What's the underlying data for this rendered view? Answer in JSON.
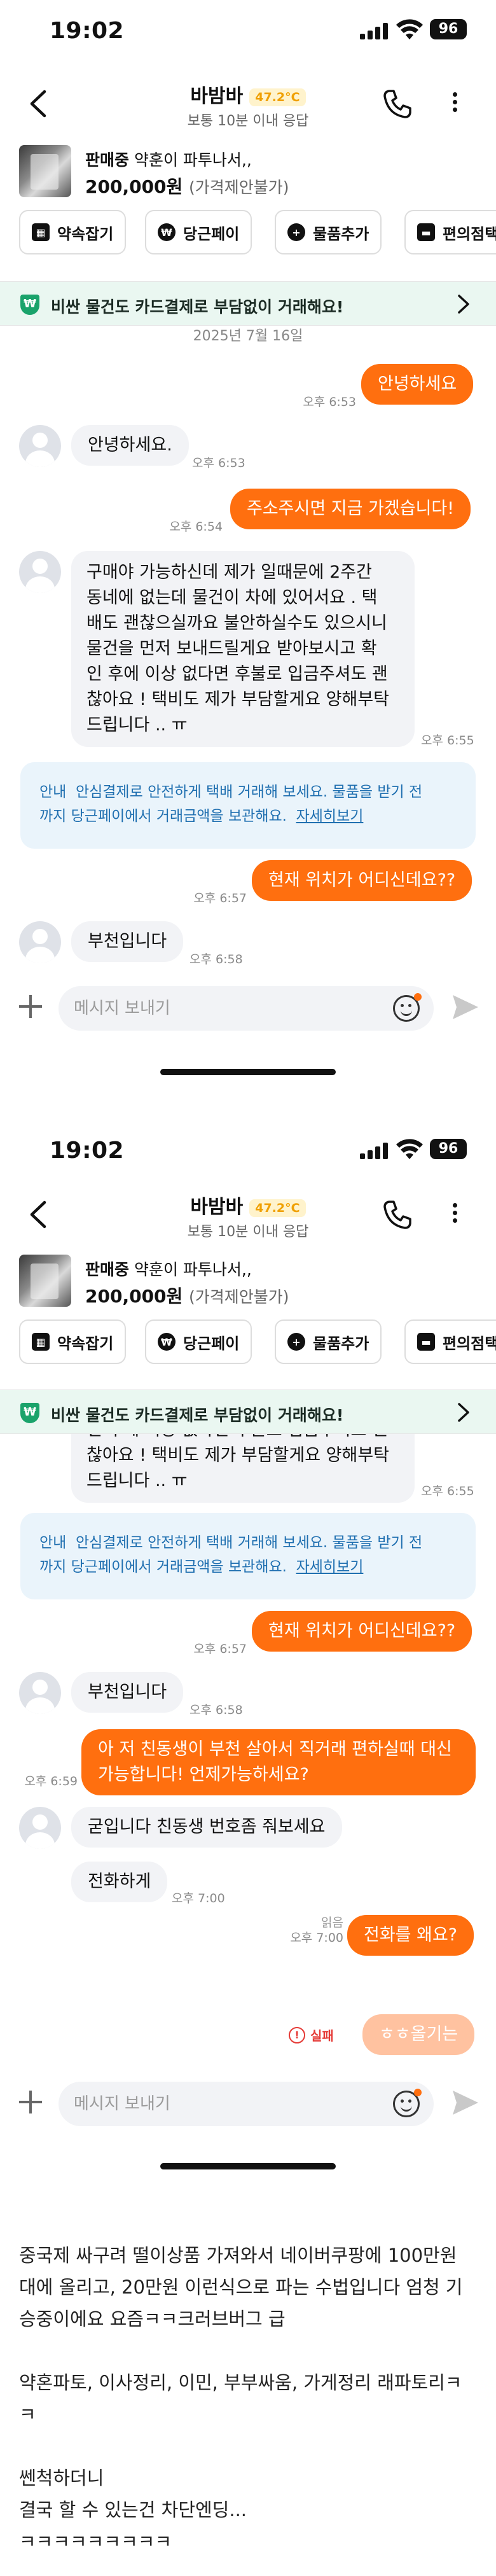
{
  "status_bar": {
    "time": "19:02",
    "battery": "96"
  },
  "header": {
    "name": "바밤바",
    "temperature": "47.2°C",
    "response": "보통 10분 이내 응답"
  },
  "product": {
    "state": "판매중",
    "title": "약훈이 파투나서,,",
    "price": "200,000원",
    "price_note": "(가격제안불가)"
  },
  "chips": [
    {
      "label": "약속잡기",
      "icon": "calendar-icon"
    },
    {
      "label": "당근페이",
      "icon": "carrot-pay-icon"
    },
    {
      "label": "물품추가",
      "icon": "plus-circle-icon"
    },
    {
      "label": "편의점택",
      "icon": "box-icon"
    }
  ],
  "banner": {
    "text": "비싼 물건도 카드결제로 부담없이 거래해요!"
  },
  "messages": {
    "date": "2025년 7월 16일",
    "m1_text": "안녕하세요",
    "m1_time": "오후 6:53",
    "m2_text": "안녕하세요.",
    "m2_time": "오후 6:53",
    "m3_text": "주소주시면 지금 가겠습니다!",
    "m3_time": "오후 6:54",
    "m4_line1": "구매야 가능하신데 제가 일때문에 2주간",
    "m4_line2": "동네에 없는데 물건이 차에 있어서요 . 택",
    "m4_line3": "배도 괜찮으실까요 불안하실수도 있으시니",
    "m4_line4": "물건을 먼저 보내드릴게요 받아보시고 확",
    "m4_line5": "인 후에 이상 없다면 후불로 입금주셔도 괜",
    "m4_line6": "찮아요 ! 택비도 제가 부담할게요 양해부탁",
    "m4_line7": "드립니다 .. ㅠ",
    "m4_time": "오후 6:55",
    "notice_prefix": "안내",
    "notice_line1": "안심결제로 안전하게 택배 거래해 보세요. 물품을 받기 전",
    "notice_line2": "까지 당근페이에서 거래금액을 보관해요.",
    "notice_link": "자세히보기",
    "m5_text": "현재 위치가 어디신데요??",
    "m5_time": "오후 6:57",
    "m6_text": "부천입니다",
    "m6_time": "오후 6:58",
    "m7_line1": "아 저 친동생이 부천 살아서 직거래 편하실때 대신",
    "m7_line2": "가능합니다! 언제가능하세요?",
    "m7_time": "오후 6:59",
    "m8_text": "굳입니다 친동생 번호좀 줘보세요",
    "m9_text": "전화하게",
    "m9_time": "오후 7:00",
    "m10_text": "전화를 왜요?",
    "m10_read": "읽음",
    "m10_time": "오후 7:00",
    "m11_text": "ㅎㅎ올기는",
    "m11_fail": "실패"
  },
  "composer": {
    "placeholder": "메시지 보내기"
  },
  "article": {
    "p1_line1": "중국제 싸구려 떨이상품 가져와서 네이버쿠팡에 100만원",
    "p1_line2": "대에 올리고, 20만원 이런식으로 파는 수법입니다 엄청 기",
    "p1_line3": "승중이에요 요즘ㅋㅋ크러브버그 급",
    "p2_line1": "약혼파토, 이사정리, 이민, 부부싸움, 가게정리 래파토리ㅋ",
    "p2_line2": "ㅋ",
    "p3_line1": "쎈척하더니",
    "p3_line2": "결국 할 수 있는건 차단엔딩...",
    "p3_line3": "ㅋㅋㅋㅋㅋㅋㅋㅋㅋ"
  },
  "colors": {
    "brand_orange": "#ff6f0f",
    "failed_orange": "#ffc2a0",
    "incoming_bubble": "#f2f3f6",
    "banner_green": "#1aa36b",
    "notice_blue": "#1f6fb0"
  }
}
